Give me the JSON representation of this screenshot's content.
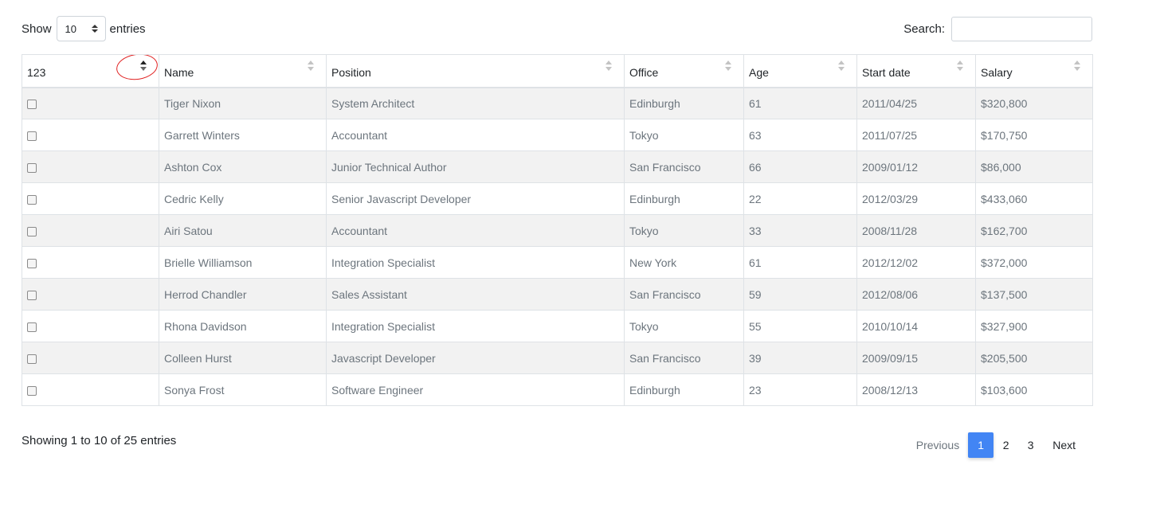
{
  "length_menu": {
    "prefix": "Show",
    "value": "10",
    "suffix": "entries"
  },
  "search": {
    "label": "Search:",
    "value": ""
  },
  "table": {
    "columns": [
      {
        "label": "123",
        "sort": "active"
      },
      {
        "label": "Name",
        "sort": "none"
      },
      {
        "label": "Position",
        "sort": "none"
      },
      {
        "label": "Office",
        "sort": "none"
      },
      {
        "label": "Age",
        "sort": "none"
      },
      {
        "label": "Start date",
        "sort": "none"
      },
      {
        "label": "Salary",
        "sort": "none"
      }
    ],
    "rows": [
      {
        "checked": false,
        "name": "Tiger Nixon",
        "position": "System Architect",
        "office": "Edinburgh",
        "age": "61",
        "start": "2011/04/25",
        "salary": "$320,800"
      },
      {
        "checked": false,
        "name": "Garrett Winters",
        "position": "Accountant",
        "office": "Tokyo",
        "age": "63",
        "start": "2011/07/25",
        "salary": "$170,750"
      },
      {
        "checked": false,
        "name": "Ashton Cox",
        "position": "Junior Technical Author",
        "office": "San Francisco",
        "age": "66",
        "start": "2009/01/12",
        "salary": "$86,000"
      },
      {
        "checked": false,
        "name": "Cedric Kelly",
        "position": "Senior Javascript Developer",
        "office": "Edinburgh",
        "age": "22",
        "start": "2012/03/29",
        "salary": "$433,060"
      },
      {
        "checked": false,
        "name": "Airi Satou",
        "position": "Accountant",
        "office": "Tokyo",
        "age": "33",
        "start": "2008/11/28",
        "salary": "$162,700"
      },
      {
        "checked": false,
        "name": "Brielle Williamson",
        "position": "Integration Specialist",
        "office": "New York",
        "age": "61",
        "start": "2012/12/02",
        "salary": "$372,000"
      },
      {
        "checked": false,
        "name": "Herrod Chandler",
        "position": "Sales Assistant",
        "office": "San Francisco",
        "age": "59",
        "start": "2012/08/06",
        "salary": "$137,500"
      },
      {
        "checked": false,
        "name": "Rhona Davidson",
        "position": "Integration Specialist",
        "office": "Tokyo",
        "age": "55",
        "start": "2010/10/14",
        "salary": "$327,900"
      },
      {
        "checked": false,
        "name": "Colleen Hurst",
        "position": "Javascript Developer",
        "office": "San Francisco",
        "age": "39",
        "start": "2009/09/15",
        "salary": "$205,500"
      },
      {
        "checked": false,
        "name": "Sonya Frost",
        "position": "Software Engineer",
        "office": "Edinburgh",
        "age": "23",
        "start": "2008/12/13",
        "salary": "$103,600"
      }
    ]
  },
  "info": "Showing 1 to 10 of 25 entries",
  "pagination": {
    "previous": "Previous",
    "pages": [
      "1",
      "2",
      "3"
    ],
    "current": "1",
    "next": "Next"
  },
  "colors": {
    "accent": "#4285f4",
    "stripe": "#f2f2f2",
    "highlight_annotation": "#e02020"
  }
}
